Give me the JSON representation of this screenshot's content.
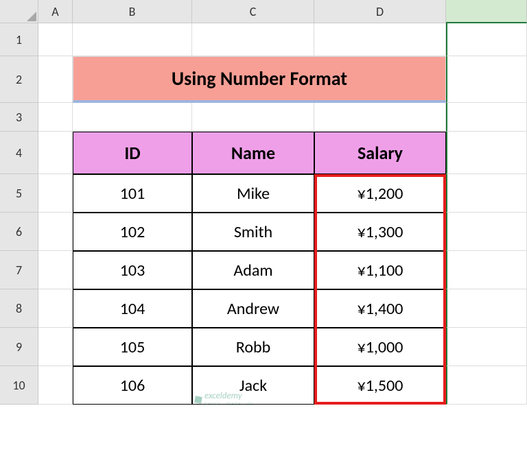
{
  "columns": [
    "A",
    "B",
    "C",
    "D"
  ],
  "rows": [
    "1",
    "2",
    "3",
    "4",
    "5",
    "6",
    "7",
    "8",
    "9",
    "10"
  ],
  "title": "Using Number Format",
  "headers": {
    "id": "ID",
    "name": "Name",
    "salary": "Salary"
  },
  "data": [
    {
      "id": "101",
      "name": "Mike",
      "salary": "¥1,200"
    },
    {
      "id": "102",
      "name": "Smith",
      "salary": "¥1,300"
    },
    {
      "id": "103",
      "name": "Adam",
      "salary": "¥1,100"
    },
    {
      "id": "104",
      "name": "Andrew",
      "salary": "¥1,400"
    },
    {
      "id": "105",
      "name": "Robb",
      "salary": "¥1,000"
    },
    {
      "id": "106",
      "name": "Jack",
      "salary": "¥1,500"
    }
  ],
  "watermark": {
    "brand": "exceldemy",
    "tagline": "EXCEL · DATA · BI"
  },
  "chart_data": {
    "type": "table",
    "title": "Using Number Format",
    "columns": [
      "ID",
      "Name",
      "Salary"
    ],
    "rows": [
      [
        "101",
        "Mike",
        "¥1,200"
      ],
      [
        "102",
        "Smith",
        "¥1,300"
      ],
      [
        "103",
        "Adam",
        "¥1,100"
      ],
      [
        "104",
        "Andrew",
        "¥1,400"
      ],
      [
        "105",
        "Robb",
        "¥1,000"
      ],
      [
        "106",
        "Jack",
        "¥1,500"
      ]
    ]
  }
}
